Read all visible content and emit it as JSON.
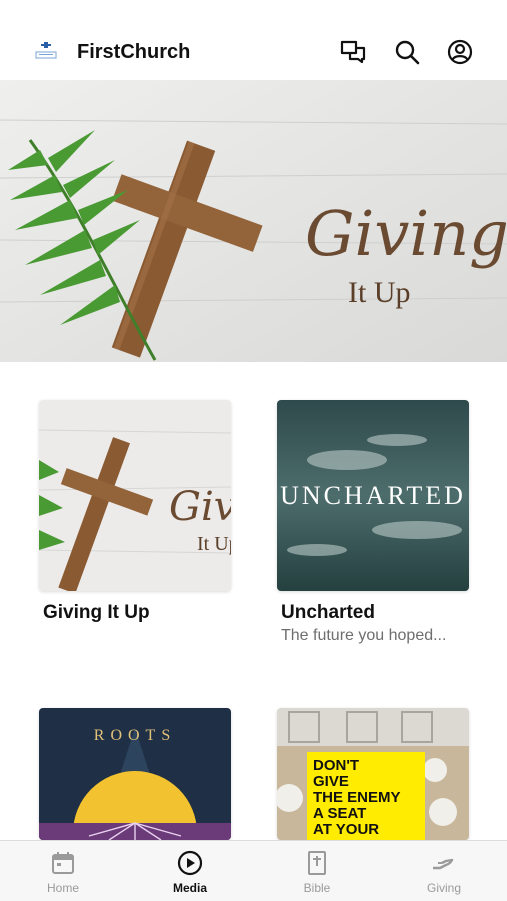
{
  "header": {
    "app_name": "FirstChurch",
    "icons": [
      "messages-icon",
      "search-icon",
      "profile-icon"
    ]
  },
  "hero": {
    "title": "Giving",
    "subtitle": "It Up"
  },
  "media": [
    {
      "title": "Giving It Up",
      "subtitle": "",
      "art_title": "Giving",
      "art_subtitle": "It Up"
    },
    {
      "title": "Uncharted",
      "subtitle": "The future you hoped...",
      "art_title": "UNCHARTED"
    },
    {
      "title": "",
      "subtitle": "",
      "art_title": "ROOTS"
    },
    {
      "title": "",
      "subtitle": "",
      "art_text": [
        "DON'T",
        "GIVE",
        "THE ENEMY",
        "A SEAT",
        "AT YOUR"
      ]
    }
  ],
  "tabs": [
    {
      "label": "Home",
      "icon": "calendar-icon",
      "active": false
    },
    {
      "label": "Media",
      "icon": "play-icon",
      "active": true
    },
    {
      "label": "Bible",
      "icon": "bible-icon",
      "active": false
    },
    {
      "label": "Giving",
      "icon": "giving-icon",
      "active": false
    }
  ],
  "colors": {
    "text": "#111111",
    "muted": "#6e6e6e",
    "tab_inactive": "#9a9a9a",
    "roots_bg": "#1f2f45",
    "roots_sun": "#f2c230",
    "roots_band": "#6b3a78",
    "sign_yellow": "#ffec00"
  }
}
